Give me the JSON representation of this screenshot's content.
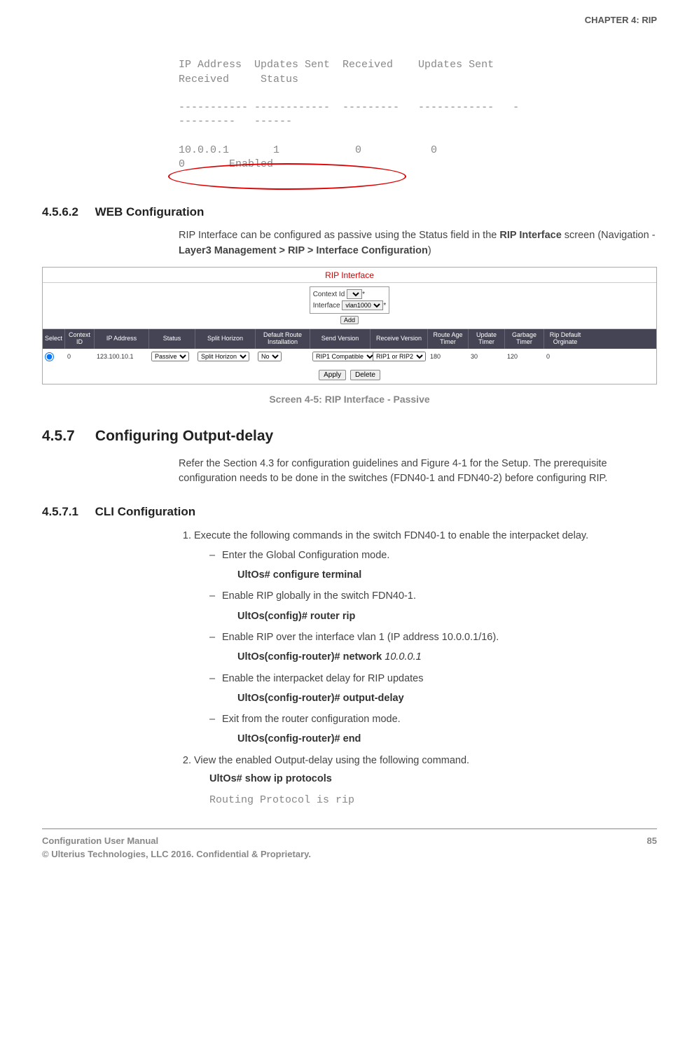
{
  "header": {
    "chapter": "CHAPTER 4: RIP"
  },
  "code_output": {
    "line1": "IP Address  Updates Sent  Received    Updates Sent",
    "line2": "Received     Status",
    "line3": "----------- ------------  ---------   ------------   -",
    "line4": "---------   ------",
    "line5": "10.0.0.1       1            0           0",
    "line6": "0       Enabled"
  },
  "sec_4562": {
    "num": "4.5.6.2",
    "title": "WEB Configuration",
    "para_a": "RIP Interface can be configured as passive using the Status field in the ",
    "para_b": "RIP Interface",
    "para_c": " screen (Navigation - ",
    "para_d": "Layer3 Management > RIP > Interface Configuration",
    "para_e": ")"
  },
  "screenshot": {
    "title": "RIP Interface",
    "context_label": "Context Id",
    "interface_label": "Interface",
    "interface_value": "vlan1000",
    "add": "Add",
    "headers": {
      "select": "Select",
      "ctx": "Context ID",
      "ip": "IP Address",
      "status": "Status",
      "split": "Split Horizon",
      "def": "Default Route Installation",
      "send": "Send Version",
      "recv": "Receive Version",
      "rage": "Route Age Timer",
      "upd": "Update Timer",
      "garb": "Garbage Timer",
      "ripd": "Rip Default Orginate"
    },
    "row": {
      "ctx": "0",
      "ip": "123.100.10.1",
      "status": "Passive",
      "split": "Split Horizon",
      "def": "No",
      "send": "RIP1 Compatible",
      "recv": "RIP1 or RIP2",
      "rage": "180",
      "upd": "30",
      "garb": "120",
      "ripd": "0"
    },
    "apply": "Apply",
    "delete": "Delete"
  },
  "caption45": "Screen 4-5: RIP Interface - Passive",
  "sec_457": {
    "num": "4.5.7",
    "title": "Configuring Output-delay",
    "para": "Refer the Section 4.3 for configuration guidelines and Figure 4-1 for the Setup. The prerequisite configuration needs to be done in the switches (FDN40-1 and FDN40-2) before configuring RIP."
  },
  "sec_4571": {
    "num": "4.5.7.1",
    "title": "CLI Configuration",
    "step1": "Execute the following commands in the switch FDN40-1 to enable the interpacket delay.",
    "s1a": "Enter the Global Configuration mode.",
    "c1a": "UltOs# configure terminal",
    "s1b": "Enable RIP globally in the switch FDN40-1.",
    "c1b": "UltOs(config)# router rip",
    "s1c": "Enable RIP over the interface vlan 1 (IP address 10.0.0.1/16).",
    "c1c_a": "UltOs(config-router)# network ",
    "c1c_b": "10.0.0.1",
    "s1d": "Enable the interpacket delay for RIP updates",
    "c1d": "UltOs(config-router)# output-delay",
    "s1e": "Exit from the router configuration mode.",
    "c1e": "UltOs(config-router)# end",
    "step2": "View the enabled Output-delay using the following command.",
    "c2": "UltOs# show ip protocols",
    "out2": "Routing Protocol is rip"
  },
  "footer": {
    "left1": "Configuration User Manual",
    "left2": "© Ulterius Technologies, LLC 2016. Confidential & Proprietary.",
    "page": "85"
  }
}
